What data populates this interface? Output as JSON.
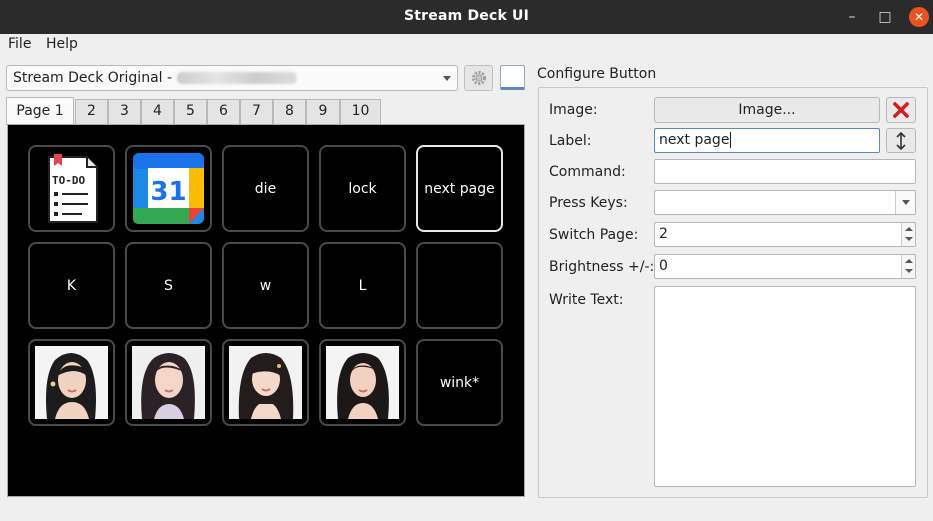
{
  "window": {
    "title": "Stream Deck UI"
  },
  "menu": {
    "file": "File",
    "help": "Help"
  },
  "device": {
    "name": "Stream Deck Original - ",
    "icon": "gear-icon"
  },
  "tabs": [
    "Page 1",
    "2",
    "3",
    "4",
    "5",
    "6",
    "7",
    "8",
    "9",
    "10"
  ],
  "active_tab": "Page 1",
  "keys": [
    {
      "label": "",
      "icon": "todo-list-icon"
    },
    {
      "label": "",
      "icon": "calendar-icon",
      "icon_text": "31"
    },
    {
      "label": "die"
    },
    {
      "label": "lock"
    },
    {
      "label": "next page",
      "selected": true
    },
    {
      "label": "K"
    },
    {
      "label": "S"
    },
    {
      "label": "w"
    },
    {
      "label": "L"
    },
    {
      "label": ""
    },
    {
      "label": "",
      "icon": "portrait-photo-1"
    },
    {
      "label": "",
      "icon": "portrait-photo-2"
    },
    {
      "label": "",
      "icon": "portrait-photo-3"
    },
    {
      "label": "",
      "icon": "portrait-photo-4"
    },
    {
      "label": "wink*"
    }
  ],
  "todo_icon_text": "TO-DO",
  "config": {
    "title": "Configure Button",
    "image_label": "Image:",
    "image_button": "Image...",
    "label_label": "Label:",
    "label_value": "next page",
    "command_label": "Command:",
    "command_value": "",
    "press_keys_label": "Press Keys:",
    "press_keys_value": "",
    "switch_page_label": "Switch Page:",
    "switch_page_value": "2",
    "brightness_label": "Brightness +/-:",
    "brightness_value": "0",
    "write_text_label": "Write Text:",
    "write_text_value": ""
  },
  "colors": {
    "titlebar": "#2b2b2b",
    "close": "#e95420",
    "grid_bg": "#000000",
    "clear_x": "#d02020"
  }
}
